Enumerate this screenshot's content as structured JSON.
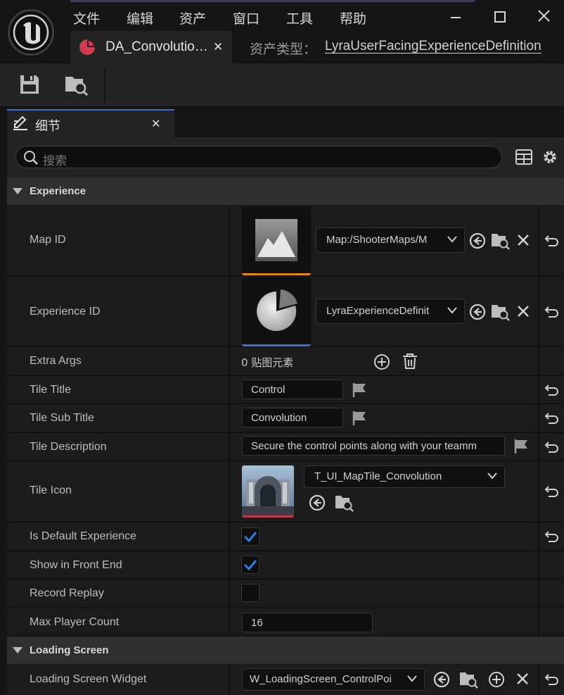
{
  "menu": [
    "文件",
    "编辑",
    "资产",
    "窗口",
    "工具",
    "帮助"
  ],
  "doc_tab": {
    "title": "DA_Convolutio…",
    "close": "✕"
  },
  "asset_type": {
    "label": "资产类型：",
    "value": "LyraUserFacingExperienceDefinition"
  },
  "details_tab": {
    "label": "细节",
    "close": "✕"
  },
  "search": {
    "placeholder": "搜索"
  },
  "categories": {
    "experience": "Experience",
    "loading_screen": "Loading Screen"
  },
  "properties": {
    "map_id": {
      "label": "Map ID",
      "value": "Map:/ShooterMaps/M"
    },
    "experience_id": {
      "label": "Experience ID",
      "value": "LyraExperienceDefinit"
    },
    "extra_args": {
      "label": "Extra Args",
      "value": "0 贴图元素"
    },
    "tile_title": {
      "label": "Tile Title",
      "value": "Control"
    },
    "tile_sub_title": {
      "label": "Tile Sub Title",
      "value": "Convolution"
    },
    "tile_description": {
      "label": "Tile Description",
      "value": "Secure the control points along with your teamm"
    },
    "tile_icon": {
      "label": "Tile Icon",
      "value": "T_UI_MapTile_Convolution"
    },
    "is_default_experience": {
      "label": "Is Default Experience",
      "checked": true
    },
    "show_in_front_end": {
      "label": "Show in Front End",
      "checked": true
    },
    "record_replay": {
      "label": "Record Replay",
      "checked": false
    },
    "max_player_count": {
      "label": "Max Player Count",
      "value": "16"
    },
    "loading_screen_widget": {
      "label": "Loading Screen Widget",
      "value": "W_LoadingScreen_ControlPoi"
    }
  },
  "colors": {
    "accent_blue": "#3b6fd6",
    "map_orange": "#e08a1a",
    "check_blue": "#2f7de1",
    "icon_red": "#d33b55"
  }
}
